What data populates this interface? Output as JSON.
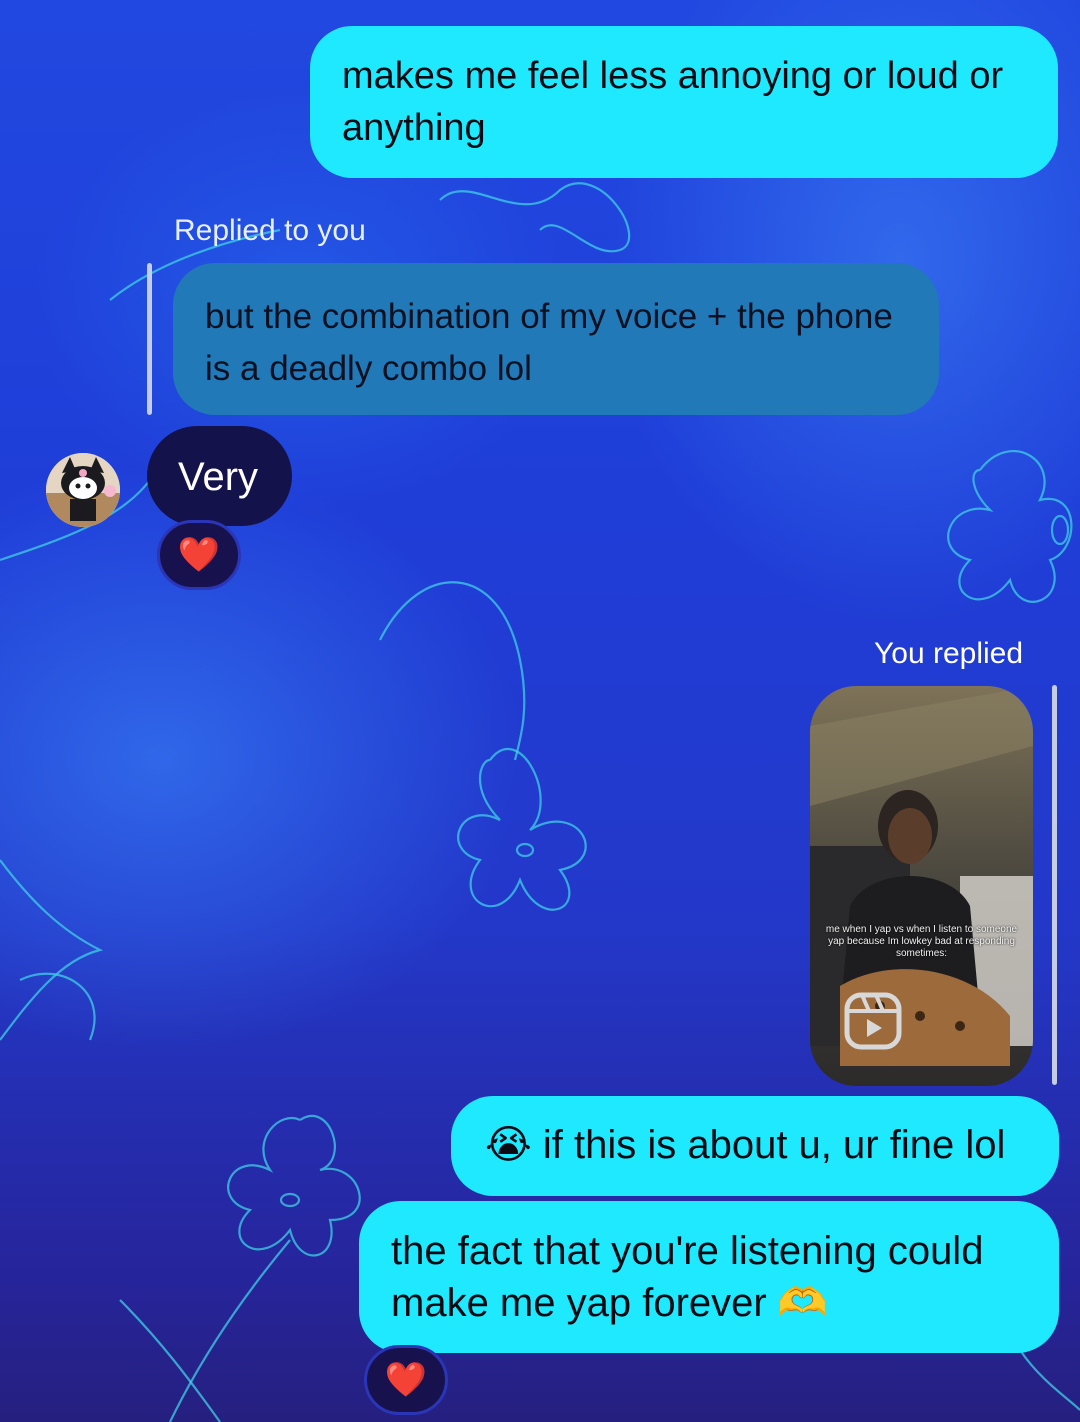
{
  "messages": [
    {
      "id": "m1",
      "sender": "you",
      "text": "makes me feel less annoying or loud or anything"
    },
    {
      "id": "m2",
      "sender": "them",
      "reply_label": "Replied to you",
      "text": "but the combination of my voice + the phone is a deadly combo lol"
    },
    {
      "id": "m3",
      "sender": "them",
      "text": "Very",
      "reaction": "❤️"
    },
    {
      "id": "m4",
      "sender": "you",
      "reply_label": "You replied",
      "attachment": {
        "type": "reel",
        "caption": "me when I yap vs when I listen to someone yap because Im lowkey bad at responding sometimes:",
        "icon": "reels-icon"
      }
    },
    {
      "id": "m5",
      "sender": "you",
      "emoji": "😭",
      "text": "if this is about u, ur fine lol"
    },
    {
      "id": "m6",
      "sender": "you",
      "text": "the fact that you're listening could make me yap forever",
      "emoji": "🫶",
      "reaction": "❤️"
    }
  ],
  "colors": {
    "sent_bubble": "#1ee9ff",
    "reply_bubble": "#2179b8",
    "received_bubble": "#14124a",
    "heart": "#e61b3a"
  }
}
